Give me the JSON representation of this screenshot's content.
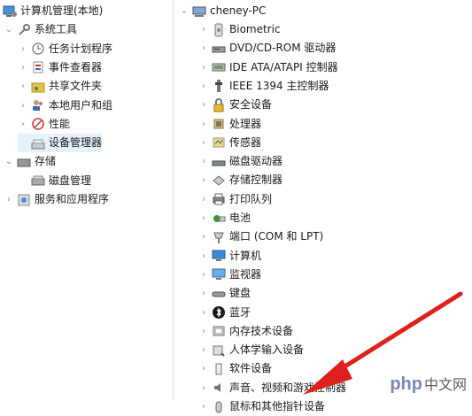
{
  "left_tree": [
    {
      "label": "计算机管理(本地)",
      "level": 0,
      "chevron": "",
      "icon": "computer-mgmt-icon"
    },
    {
      "label": "系统工具",
      "level": 1,
      "chevron": "down",
      "icon": "tools-icon"
    },
    {
      "label": "任务计划程序",
      "level": 2,
      "chevron": "right",
      "icon": "task-scheduler-icon"
    },
    {
      "label": "事件查看器",
      "level": 2,
      "chevron": "right",
      "icon": "event-viewer-icon"
    },
    {
      "label": "共享文件夹",
      "level": 2,
      "chevron": "right",
      "icon": "shared-folder-icon"
    },
    {
      "label": "本地用户和组",
      "level": 2,
      "chevron": "right",
      "icon": "users-icon"
    },
    {
      "label": "性能",
      "level": 2,
      "chevron": "right",
      "icon": "performance-icon"
    },
    {
      "label": "设备管理器",
      "level": 2,
      "chevron": "",
      "icon": "device-manager-icon",
      "selected": true
    },
    {
      "label": "存储",
      "level": 1,
      "chevron": "down",
      "icon": "storage-icon"
    },
    {
      "label": "磁盘管理",
      "level": 2,
      "chevron": "",
      "icon": "disk-mgmt-icon"
    },
    {
      "label": "服务和应用程序",
      "level": 1,
      "chevron": "right",
      "icon": "services-icon"
    }
  ],
  "right_tree": {
    "root": {
      "label": "cheney-PC",
      "icon": "pc-icon"
    },
    "items": [
      {
        "label": "Biometric",
        "icon": "biometric-icon"
      },
      {
        "label": "DVD/CD-ROM 驱动器",
        "icon": "dvd-icon"
      },
      {
        "label": "IDE ATA/ATAPI 控制器",
        "icon": "ide-icon"
      },
      {
        "label": "IEEE 1394 主控制器",
        "icon": "ieee1394-icon"
      },
      {
        "label": "安全设备",
        "icon": "security-icon"
      },
      {
        "label": "处理器",
        "icon": "processor-icon"
      },
      {
        "label": "传感器",
        "icon": "sensor-icon"
      },
      {
        "label": "磁盘驱动器",
        "icon": "disk-drive-icon"
      },
      {
        "label": "存储控制器",
        "icon": "storage-controller-icon"
      },
      {
        "label": "打印队列",
        "icon": "printer-icon"
      },
      {
        "label": "电池",
        "icon": "battery-icon"
      },
      {
        "label": "端口 (COM 和 LPT)",
        "icon": "port-icon"
      },
      {
        "label": "计算机",
        "icon": "computer-icon"
      },
      {
        "label": "监视器",
        "icon": "monitor-icon"
      },
      {
        "label": "键盘",
        "icon": "keyboard-icon"
      },
      {
        "label": "蓝牙",
        "icon": "bluetooth-icon"
      },
      {
        "label": "内存技术设备",
        "icon": "memory-icon"
      },
      {
        "label": "人体学输入设备",
        "icon": "hid-icon"
      },
      {
        "label": "软件设备",
        "icon": "software-device-icon"
      },
      {
        "label": "声音、视频和游戏控制器",
        "icon": "sound-icon"
      },
      {
        "label": "鼠标和其他指针设备",
        "icon": "mouse-icon"
      }
    ]
  },
  "colors": {
    "arrow": "#e0201d",
    "selected_bg": "#e5f1fb",
    "accent": "#2b6cc4"
  },
  "watermark": {
    "brand": "php",
    "suffix": "中文网"
  }
}
